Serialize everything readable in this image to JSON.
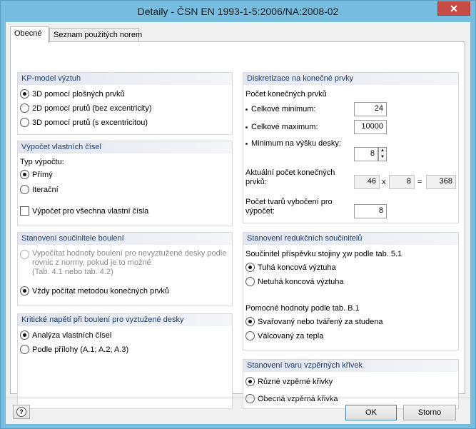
{
  "window": {
    "title": "Detaily - ČSN EN 1993-1-5:2006/NA:2008-02",
    "close": "✕"
  },
  "tabs": [
    {
      "label": "Obecné"
    },
    {
      "label": "Seznam použitých norem"
    }
  ],
  "kp_model": {
    "title": "KP-model výztuh",
    "options": [
      {
        "label": "3D pomocí plošných prvků",
        "selected": true
      },
      {
        "label": "2D pomocí prutů (bez excentricity)",
        "selected": false
      },
      {
        "label": "3D pomocí prutů (s excentricitou)",
        "selected": false
      }
    ]
  },
  "eigen": {
    "title": "Výpočet vlastních čísel",
    "type_label": "Typ výpočtu:",
    "options": [
      {
        "label": "Přímý",
        "selected": true
      },
      {
        "label": "Iterační",
        "selected": false
      }
    ],
    "all_label": "Výpočet pro všechna vlastní čísla"
  },
  "buckling_factor": {
    "title": "Stanovení součinitele boulení",
    "option1_lines": [
      "Vypočítat hodnoty boulení pro nevyztužené desky podle",
      "rovnic z normy, pokud je to možné",
      "(Tab. 4.1 nebo tab. 4.2)"
    ],
    "option2": "Vždy počítat metodou konečných prvků"
  },
  "critical": {
    "title": "Kritické napětí při boulení pro vyztužené desky",
    "options": [
      {
        "label": "Analýza vlastních čísel",
        "selected": true
      },
      {
        "label": "Podle přílohy (A.1; A.2; A.3)",
        "selected": false
      }
    ]
  },
  "discretization": {
    "title": "Diskretizace na konečné prvky",
    "count_label": "Počet konečných prvků",
    "min_total_label": "Celkové minimum:",
    "min_total": "24",
    "max_total_label": "Celkové maximum:",
    "max_total": "10000",
    "min_height_label": "Minimum na výšku desky:",
    "min_height": "8",
    "current_label_1": "Aktuální počet konečných",
    "current_label_2": "prvků:",
    "current_a": "46",
    "times": "x",
    "current_b": "8",
    "equals": "=",
    "current_total": "368",
    "modes_label_1": "Počet tvarů vybočení pro",
    "modes_label_2": "výpočet:",
    "modes": "8"
  },
  "reduction": {
    "title": "Stanovení redukčních součinitelů",
    "web_label": "Součinitel příspěvku stojiny χw podle tab. 5.1",
    "web_options": [
      {
        "label": "Tuhá koncová výztuha",
        "selected": true
      },
      {
        "label": "Netuhá koncová výztuha",
        "selected": false
      }
    ],
    "aux_label": "Pomocné hodnoty podle tab. B.1",
    "aux_options": [
      {
        "label": "Svařovaný nebo tvářený za studena",
        "selected": true
      },
      {
        "label": "Válcovaný za tepla",
        "selected": false
      }
    ]
  },
  "curves": {
    "title": "Stanovení tvaru vzpěrných křivek",
    "options": [
      {
        "label": "Různé vzpěrné křivky",
        "selected": true
      },
      {
        "label": "Obecná vzpěrná křivka",
        "selected": false
      }
    ]
  },
  "footer": {
    "ok": "OK",
    "cancel": "Storno",
    "help": "?"
  }
}
